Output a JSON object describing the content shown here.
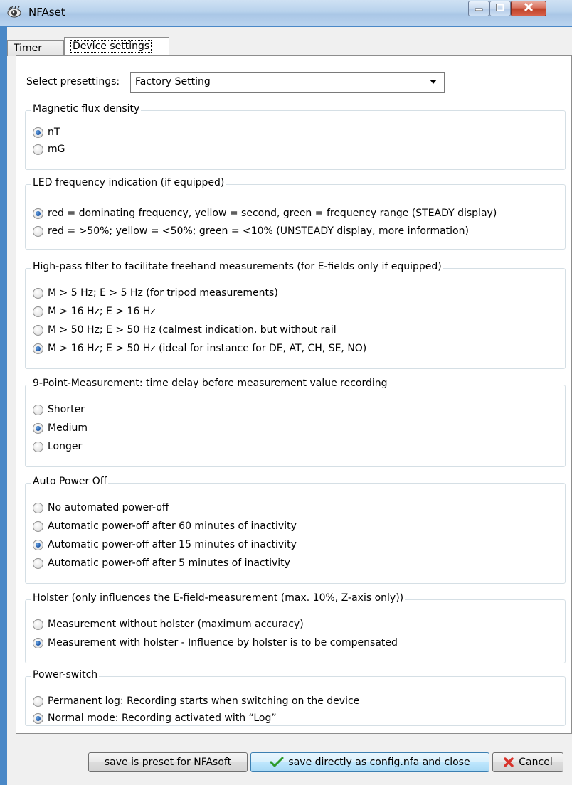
{
  "window": {
    "title": "NFAset"
  },
  "tabs": [
    {
      "label": "Timer",
      "active": false
    },
    {
      "label": "Device settings",
      "active": true
    }
  ],
  "presets": {
    "label": "Select presettings:",
    "value": "Factory Setting"
  },
  "groups": [
    {
      "title": "Magnetic flux density",
      "options": [
        {
          "label": "nT",
          "checked": true
        },
        {
          "label": "mG",
          "checked": false
        }
      ]
    },
    {
      "title": "LED frequency indication (if equipped)",
      "options": [
        {
          "label": "red = dominating frequency, yellow = second, green = frequency range (STEADY display)",
          "checked": true
        },
        {
          "label": "red = >50%; yellow = <50%; green = <10% (UNSTEADY display, more information)",
          "checked": false
        }
      ]
    },
    {
      "title": "High-pass filter to facilitate freehand measurements (for E-fields only if equipped)",
      "options": [
        {
          "label": "M > 5 Hz; E > 5 Hz (for tripod measurements)",
          "checked": false
        },
        {
          "label": "M > 16 Hz; E > 16 Hz",
          "checked": false
        },
        {
          "label": "M > 50 Hz; E > 50 Hz (calmest indication, but without rail",
          "checked": false
        },
        {
          "label": "M > 16 Hz; E > 50 Hz (ideal for instance for DE, AT, CH, SE, NO)",
          "checked": true
        }
      ]
    },
    {
      "title": "9-Point-Measurement: time delay before measurement value recording",
      "options": [
        {
          "label": "Shorter",
          "checked": false
        },
        {
          "label": "Medium",
          "checked": true
        },
        {
          "label": "Longer",
          "checked": false
        }
      ]
    },
    {
      "title": "Auto Power Off",
      "options": [
        {
          "label": "No automated power-off",
          "checked": false
        },
        {
          "label": "Automatic power-off after 60 minutes of inactivity",
          "checked": false
        },
        {
          "label": "Automatic power-off after 15 minutes of inactivity",
          "checked": true
        },
        {
          "label": "Automatic power-off after 5 minutes of inactivity",
          "checked": false
        }
      ]
    },
    {
      "title": "Holster (only influences the E-field-measurement (max. 10%, Z-axis only))",
      "options": [
        {
          "label": "Measurement without holster (maximum accuracy)",
          "checked": false
        },
        {
          "label": "Measurement with holster - Influence by holster is to be compensated",
          "checked": true
        }
      ]
    },
    {
      "title": "Power-switch",
      "options": [
        {
          "label": "Permanent log: Recording starts when switching on the device",
          "checked": false
        },
        {
          "label": "Normal mode: Recording activated with “Log”",
          "checked": true
        }
      ]
    }
  ],
  "buttons": {
    "preset": "save is preset for NFAsoft",
    "save": "save directly as config.nfa and close",
    "cancel": "Cancel"
  },
  "icons": {
    "app": "eye-icon",
    "save": "checkmark-icon",
    "cancel": "red-x-icon"
  },
  "colors": {
    "accent": "#1d56a6",
    "title_bar": "#b8d2ec",
    "close_button": "#c0432a"
  }
}
